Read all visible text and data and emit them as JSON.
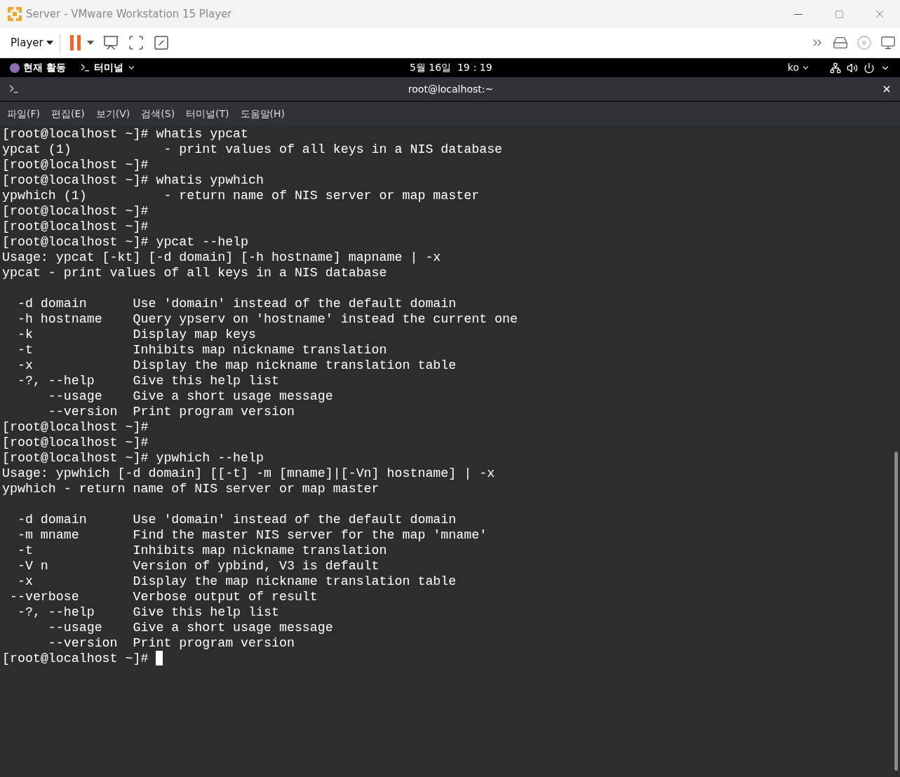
{
  "window": {
    "title": "Server - VMware Workstation 15 Player"
  },
  "toolbar": {
    "player_menu": "Player"
  },
  "top_bar": {
    "activities": "현재 활동",
    "app_menu": "터미널",
    "clock": "5월 16일  19：19",
    "input_method": "ko"
  },
  "terminal": {
    "title": "root@localhost:~",
    "menu": [
      "파일(F)",
      "편집(E)",
      "보기(V)",
      "검색(S)",
      "터미널(T)",
      "도움말(H)"
    ],
    "lines": [
      {
        "kind": "text",
        "text": "[root@localhost ~]# whatis ypcat"
      },
      {
        "kind": "text",
        "text": "ypcat (1)            - print values of all keys in a NIS database"
      },
      {
        "kind": "text",
        "text": "[root@localhost ~]#"
      },
      {
        "kind": "text",
        "text": "[root@localhost ~]# whatis ypwhich"
      },
      {
        "kind": "text",
        "text": "ypwhich (1)          - return name of NIS server or map master"
      },
      {
        "kind": "text",
        "text": "[root@localhost ~]#"
      },
      {
        "kind": "text",
        "text": "[root@localhost ~]#"
      },
      {
        "kind": "text",
        "text": "[root@localhost ~]# ypcat --help"
      },
      {
        "kind": "text",
        "text": "Usage: ypcat [-kt] [-d domain] [-h hostname] mapname | -x"
      },
      {
        "kind": "text",
        "text": "ypcat - print values of all keys in a NIS database"
      },
      {
        "kind": "blank"
      },
      {
        "kind": "text",
        "text": "  -d domain      Use 'domain' instead of the default domain"
      },
      {
        "kind": "text",
        "text": "  -h hostname    Query ypserv on 'hostname' instead the current one"
      },
      {
        "kind": "text",
        "text": "  -k             Display map keys"
      },
      {
        "kind": "text",
        "text": "  -t             Inhibits map nickname translation"
      },
      {
        "kind": "text",
        "text": "  -x             Display the map nickname translation table"
      },
      {
        "kind": "text",
        "text": "  -?, --help     Give this help list"
      },
      {
        "kind": "text",
        "text": "      --usage    Give a short usage message"
      },
      {
        "kind": "text",
        "text": "      --version  Print program version"
      },
      {
        "kind": "text",
        "text": "[root@localhost ~]#"
      },
      {
        "kind": "text",
        "text": "[root@localhost ~]#"
      },
      {
        "kind": "text",
        "text": "[root@localhost ~]# ypwhich --help"
      },
      {
        "kind": "text",
        "text": "Usage: ypwhich [-d domain] [[-t] -m [mname]|[-Vn] hostname] | -x"
      },
      {
        "kind": "text",
        "text": "ypwhich - return name of NIS server or map master"
      },
      {
        "kind": "blank"
      },
      {
        "kind": "text",
        "text": "  -d domain      Use 'domain' instead of the default domain"
      },
      {
        "kind": "text",
        "text": "  -m mname       Find the master NIS server for the map 'mname'"
      },
      {
        "kind": "text",
        "text": "  -t             Inhibits map nickname translation"
      },
      {
        "kind": "text",
        "text": "  -V n           Version of ypbind, V3 is default"
      },
      {
        "kind": "text",
        "text": "  -x             Display the map nickname translation table"
      },
      {
        "kind": "text",
        "text": " --verbose       Verbose output of result"
      },
      {
        "kind": "text",
        "text": "  -?, --help     Give this help list"
      },
      {
        "kind": "text",
        "text": "      --usage    Give a short usage message"
      },
      {
        "kind": "text",
        "text": "      --version  Print program version"
      },
      {
        "kind": "text",
        "text": "[root@localhost ~]# "
      }
    ],
    "cursor_visible": true
  }
}
